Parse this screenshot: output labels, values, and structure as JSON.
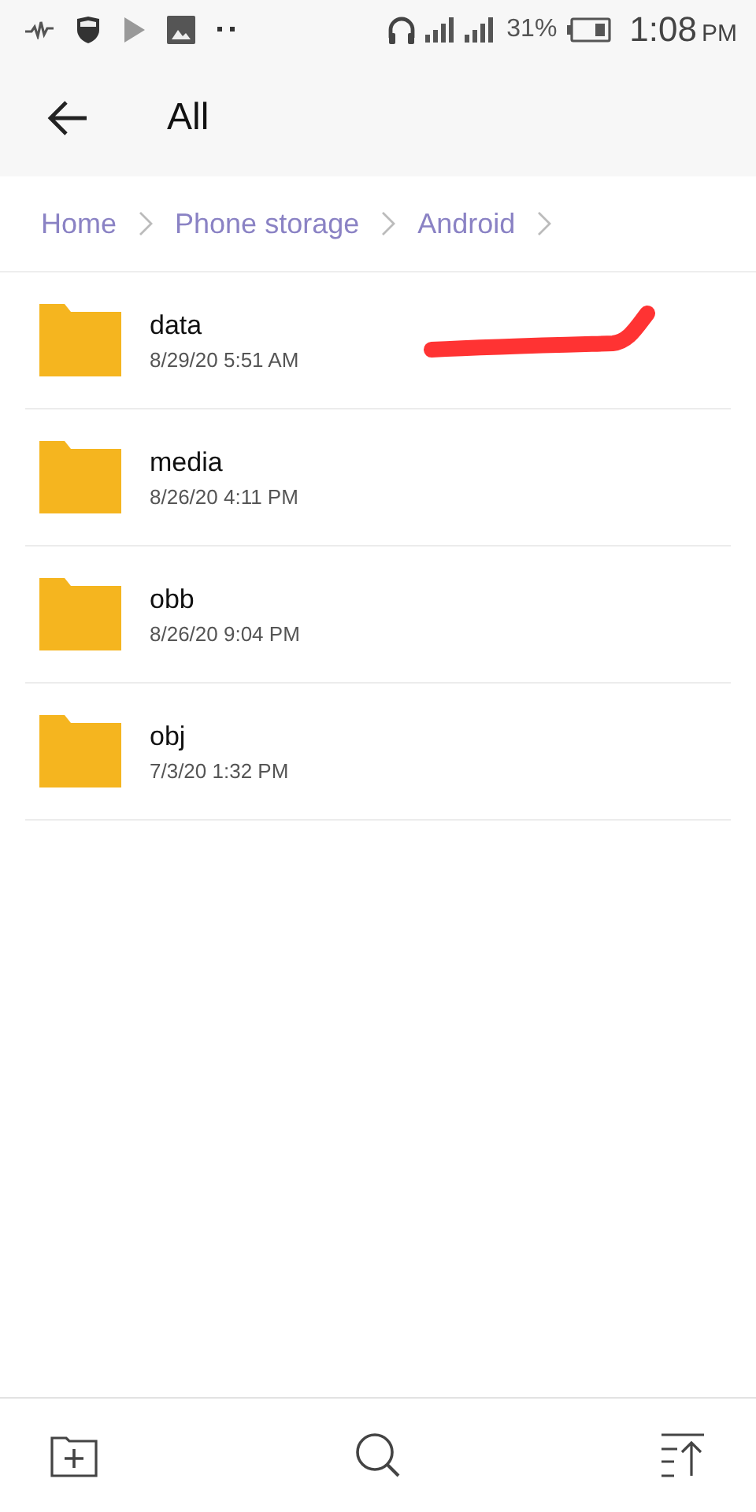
{
  "status_bar": {
    "battery": "31%",
    "time": "1:08",
    "meridiem": "PM"
  },
  "header": {
    "title": "All"
  },
  "breadcrumb": [
    "Home",
    "Phone storage",
    "Android"
  ],
  "folders": [
    {
      "name": "data",
      "date": "8/29/20 5:51 AM"
    },
    {
      "name": "media",
      "date": "8/26/20 4:11 PM"
    },
    {
      "name": "obb",
      "date": "8/26/20 9:04 PM"
    },
    {
      "name": "obj",
      "date": "7/3/20 1:32 PM"
    }
  ]
}
